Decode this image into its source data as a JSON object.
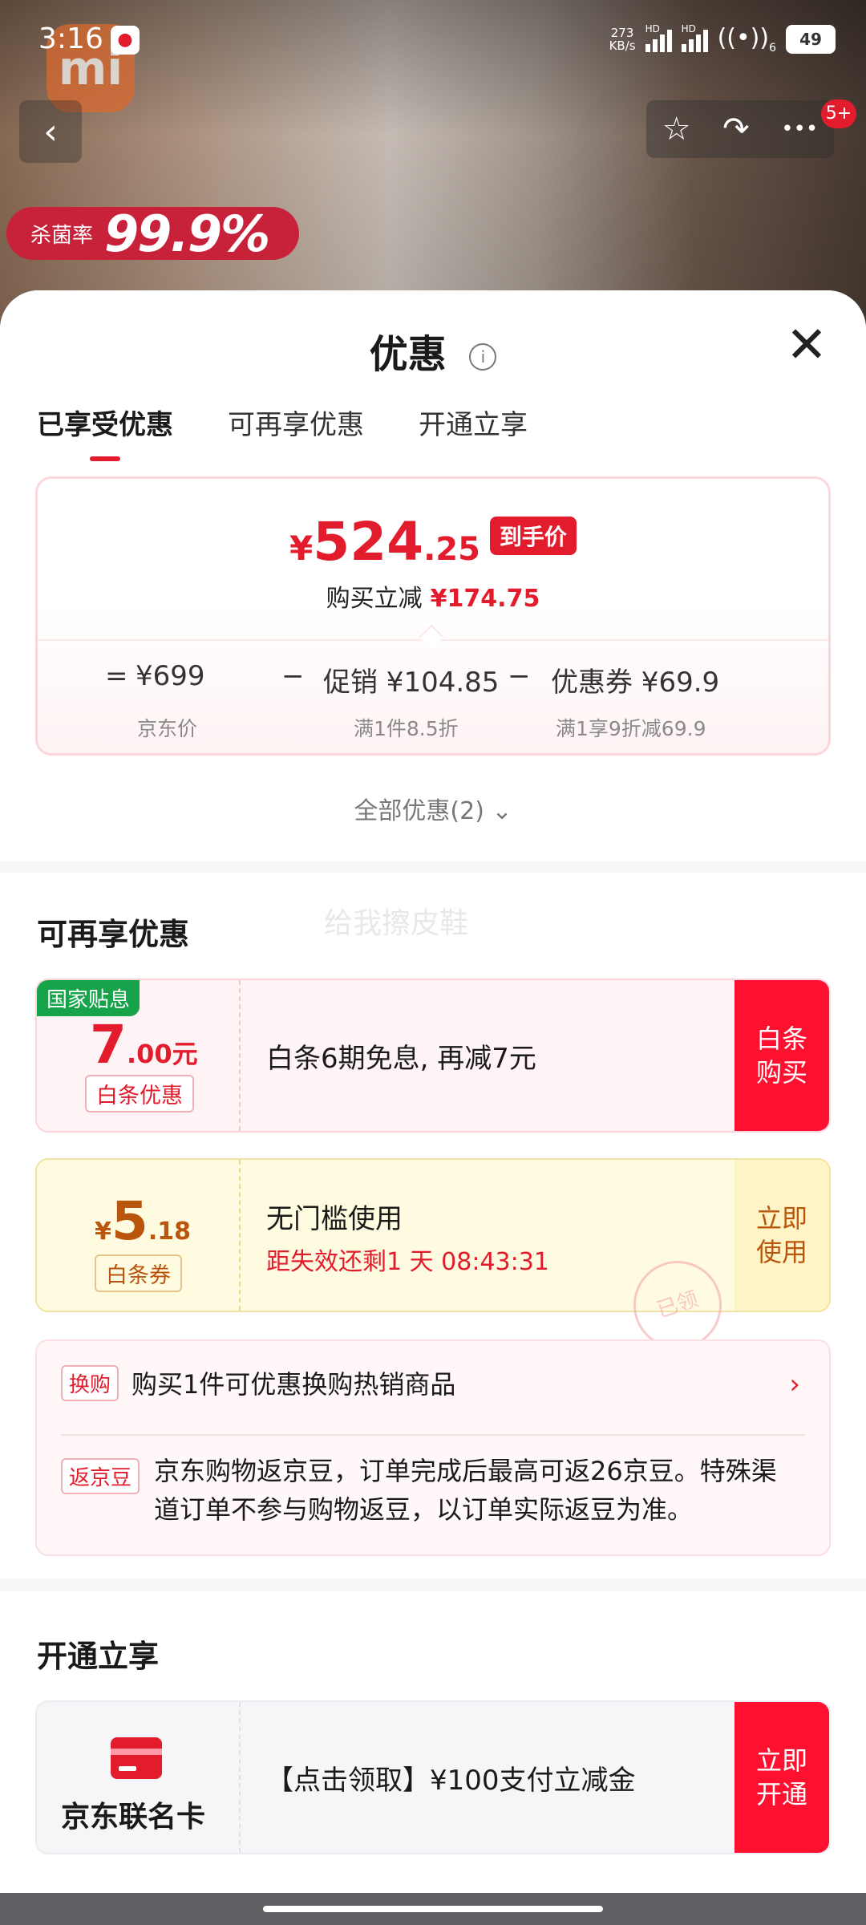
{
  "status_bar": {
    "time": "3:16",
    "net_speed_top": "273",
    "net_speed_unit": "KB/s",
    "sim1": "HD",
    "sim2": "HD",
    "wifi_sub": "6",
    "battery": "49"
  },
  "background": {
    "logo": "mi",
    "kill_label": "杀菌率",
    "kill_value": "99.9%"
  },
  "topnav": {
    "back_icon": "‹",
    "star_icon": "☆",
    "share_icon": "↷",
    "more_icon": "•••",
    "cart_badge": "5+"
  },
  "sheet": {
    "title": "优惠",
    "info_icon": "i",
    "close_icon": "✕",
    "tabs": [
      {
        "label": "已享受优惠",
        "active": true
      },
      {
        "label": "可再享优惠",
        "active": false
      },
      {
        "label": "开通立享",
        "active": false
      }
    ],
    "final_price": {
      "currency": "¥",
      "integer": "524",
      "decimal": ".25",
      "tag": "到手价"
    },
    "savings": {
      "label": "购买立减",
      "amount": "¥174.75"
    },
    "formula": {
      "equals": "=",
      "base_price": "¥699",
      "base_label": "京东价",
      "minus1": "−",
      "promo": "促销 ¥104.85",
      "promo_desc": "满1件8.5折",
      "minus2": "−",
      "coupon": "优惠券 ¥69.9",
      "coupon_desc": "满1享9折减69.9"
    },
    "all_promos": "全部优惠(2)",
    "all_promos_icon": "⌄"
  },
  "extra_section": {
    "title": "可再享优惠",
    "watermark": "给我擦皮鞋",
    "cards": [
      {
        "corner": "国家贴息",
        "amount_big": "7",
        "amount_small": ".00元",
        "chip": "白条优惠",
        "desc": "白条6期免息, 再减7元",
        "action": "白条购买",
        "action_line1": "白条",
        "action_line2": "购买"
      },
      {
        "currency": "¥",
        "amount_big": "5",
        "amount_small": ".18",
        "chip": "白条券",
        "desc": "无门槛使用",
        "countdown": "距失效还剩1 天 08:43:31",
        "action_line1": "立即",
        "action_line2": "使用",
        "stamp": "已领"
      }
    ],
    "info": {
      "trade_chip": "换购",
      "trade_text": "购买1件可优惠换购热销商品",
      "chev": "›",
      "bean_chip": "返京豆",
      "bean_line1": "京东购物返京豆，订单完成后最高可返26京豆。特殊渠",
      "bean_line2": "道订单不参与购物返豆，以订单实际返豆为准。"
    }
  },
  "open_section": {
    "title": "开通立享",
    "card": {
      "name": "京东联名卡",
      "desc": "【点击领取】¥100支付立减金",
      "action_line1": "立即",
      "action_line2": "开通"
    }
  },
  "colors": {
    "accent": "#e21c2c",
    "action_red": "#fe1030",
    "gold": "#b9550c",
    "green": "#16a34a"
  }
}
